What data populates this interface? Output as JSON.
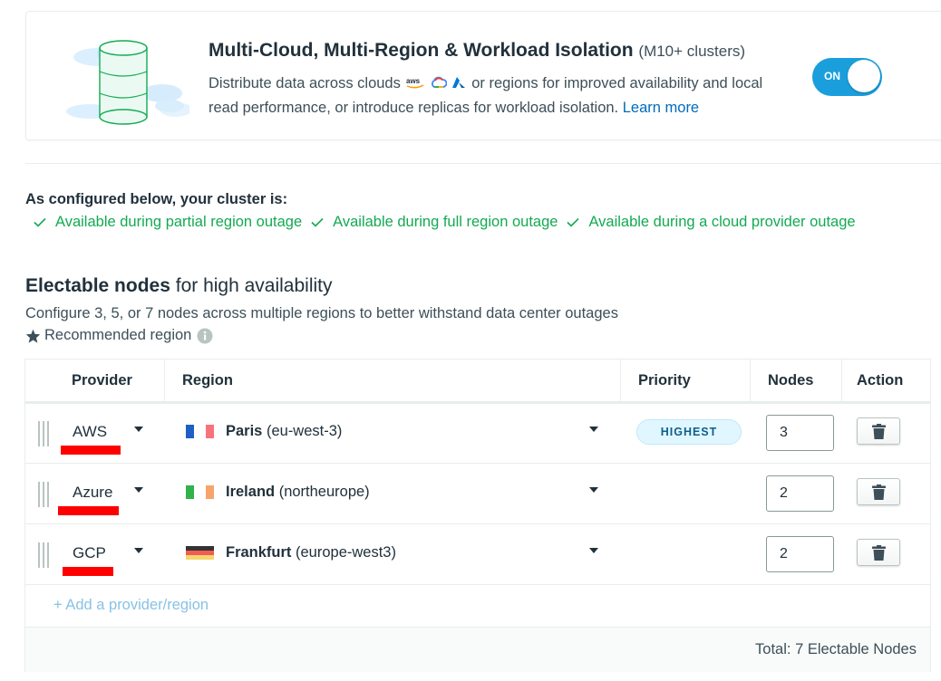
{
  "feature": {
    "title": "Multi-Cloud, Multi-Region & Workload Isolation",
    "title_suffix": "(M10+ clusters)",
    "desc_part1": "Distribute data across clouds",
    "desc_part2": "or regions for improved availability and local read performance, or introduce replicas for workload isolation.",
    "learn_more": "Learn more",
    "toggle_label": "ON",
    "cloud_icons": [
      "aws-icon",
      "google-cloud-icon",
      "azure-icon"
    ]
  },
  "config": {
    "heading": "As configured below, your cluster is:",
    "items": [
      "Available during partial region outage",
      "Available during full region outage",
      "Available during a cloud provider outage"
    ],
    "accent_color": "#13aa52"
  },
  "electable": {
    "title_bold": "Electable nodes",
    "title_rest": "for high availability",
    "description": "Configure 3, 5, or 7 nodes across multiple regions to better withstand data center outages",
    "recommended": "Recommended region"
  },
  "table": {
    "columns": [
      "Provider",
      "Region",
      "Priority",
      "Nodes",
      "Action"
    ],
    "rows": [
      {
        "provider": "AWS",
        "region_name": "Paris",
        "region_code": "(eu-west-3)",
        "priority": "HIGHEST",
        "nodes": "3",
        "flag": "france"
      },
      {
        "provider": "Azure",
        "region_name": "Ireland",
        "region_code": "(northeurope)",
        "priority": "",
        "nodes": "2",
        "flag": "ireland"
      },
      {
        "provider": "GCP",
        "region_name": "Frankfurt",
        "region_code": "(europe-west3)",
        "priority": "",
        "nodes": "2",
        "flag": "germany"
      }
    ],
    "add_link": "+ Add a provider/region",
    "total": "Total: 7 Electable Nodes"
  }
}
